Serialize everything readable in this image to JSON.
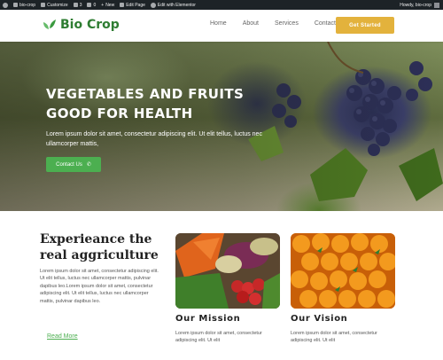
{
  "admin_bar": {
    "site": "bio-crop",
    "customize": "Customize",
    "updates": "3",
    "comments": "0",
    "new": "New",
    "edit_page": "Edit Page",
    "elementor": "Edit with Elementor",
    "howdy": "Howdy, bio-crop"
  },
  "header": {
    "logo_text": "Bio Crop",
    "nav": [
      "Home",
      "About",
      "Services",
      "Contact"
    ],
    "cta": "Get Started"
  },
  "hero": {
    "title_line1": "VEGETABLES AND FRUITS",
    "title_line2": "GOOD FOR HEALTH",
    "text": "Lorem ipsum dolor sit amet, consectetur adipiscing elit. Ut elit tellus, luctus nec ullamcorper mattis,",
    "button": "Contact Us"
  },
  "intro": {
    "title_line1": "Experieance the",
    "title_line2": "real aggriculture",
    "text": "Lorem ipsum dolor sit amet, consectetur adipiscing elit. Ut elit tellus, luctus nec ullamcorper mattis, pulvinar dapibus leo.Lorem ipsum dolor sit amet, consectetur adipiscing elit. Ut elit tellus, luctus nec ullamcorper mattis, pulvinar dapibus leo.",
    "read_more": "Read More"
  },
  "mission": {
    "title": "Our Mission",
    "text": "Lorem ipsum dolor sit amet, consectetur adipiscing elit. Ut elit"
  },
  "vision": {
    "title": "Our Vision",
    "text": "Lorem ipsum dolor sit amet, consectetur adipiscing elit. Ut elit"
  },
  "colors": {
    "brand_green": "#4caf50",
    "logo_green": "#2e7d32",
    "cta_gold": "#e3b23c",
    "admin_bar": "#1d2327"
  }
}
